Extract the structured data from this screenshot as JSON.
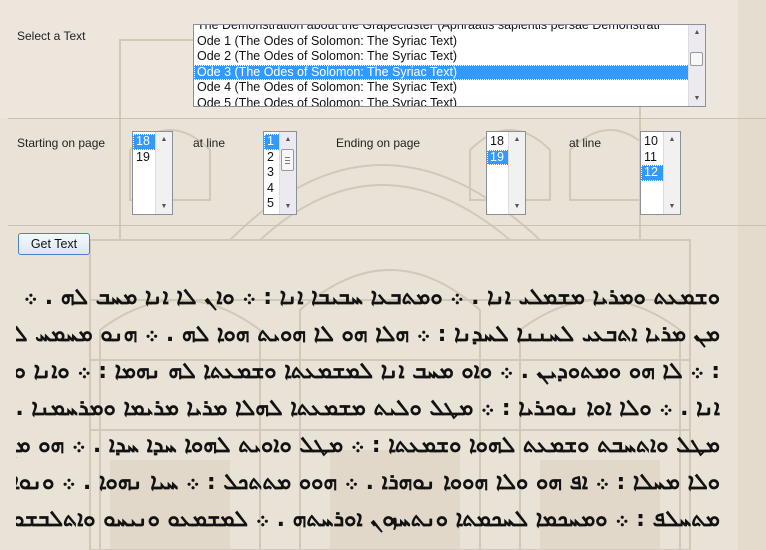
{
  "form": {
    "select_text_label": "Select a Text",
    "texts": [
      "The Demonstration about the Grapecluster (Aphraatis sapientis persae Demonstrati",
      "Ode 1 (The Odes of Solomon: The Syriac Text)",
      "Ode 2 (The Odes of Solomon: The Syriac Text)",
      "Ode 3 (The Odes of Solomon: The Syriac Text)",
      "Ode 4 (The Odes of Solomon: The Syriac Text)",
      "Ode 5 (The Odes of Solomon: The Syriac Text)"
    ],
    "selected_text": "Ode 3 (The Odes of Solomon: The Syriac Text)",
    "starting_page_label": "Starting on page",
    "start_pages": [
      "18",
      "19"
    ],
    "start_page_selected": "18",
    "start_line_label": "at line",
    "start_lines": [
      "1",
      "2",
      "3",
      "4",
      "5"
    ],
    "start_line_selected": "1",
    "ending_page_label": "Ending on page",
    "end_pages": [
      "18",
      "19"
    ],
    "end_page_selected": "19",
    "end_line_label": "at line",
    "end_lines": [
      "10",
      "11",
      "12"
    ],
    "end_line_selected": "12",
    "get_text_button": "Get Text"
  },
  "output": {
    "lines": [
      "ܘܫܡܥܬ ܘܡܪܝܐ ܡܫܡܠܝ ܐܢܐ . ܀ ܘܡܬܒܥܐ ܚܒܝܒܐ ܐܢܐ : ܀ ܘܐܢ ܠܐ ܐܢܐ ܡܚܒ ܠܗ . ܀ ܠܐ",
      "ܡܢ ܡܪܝܐ ܐܬܒܥܝ ܠܚܢܢܐ ܠܚܕܢܐ : ܀ ܗܠܐ ܗܘ ܠܐ ܗܘܝܬ ܗܘܐ ܠܗ . ܀ ܗܢܘ ܡܚܡܚ ܠܚܒܝܒܗ ܘܫܡܥܬܐ",
      ": ܀ ܠܐ ܗܘ ܘܡܬܘܕܝܢ . ܀ ܘܐܘ ܡܚܒ ܐܢܐ ܠܡܫܡܥܬܐ ܘܫܡܥܬܐ ܠܗ ܢܗܡܐ : ܀ ܘܐܢܐ ܘܡܫܡܗ ܐܦ ܐܢܐ",
      "ܐܢܐ . ܀ ܘܠܐ ܐܘܐ ܢܘܟܪܝܐ : ܀ ܡܛܠ ܘܠܝܬ ܡܫܡܥܬܐ ܠܗܠܐ ܡܪܝܐ ܡܪܝܡܐ ܘܡܪܚܡܢܐ . ܀ ܠܐܬܚܠܦܘ",
      "ܡܛܠ ܘܐܬܚܒܬ ܘܫܡܥܬ ܠܗܘܐ ܘܫܡܥܬܐ : ܀ ܡܛܠ ܘܐܘܝܬ ܠܗܘܐ ܚܕܐ ܚܕܐ . ܀ ܗܘ ܡܢ ܘܡܬܢܝܚ ܠܗܘܐ",
      "ܘܠܐ ܡܚܠܐ : ܀ ܐܦ ܗܘ ܘܠܐ ܗܘܘܐ ܢܘܗܪܐ . ܀ ܗܘܘ ܡܬܬܟܠ : ܀ ܚܝܐ ܢܗܘܐ . ܀ ܘܢܘܐ ܗܢ ܘܫܡܗ ܘܡܪܝܐ ܘܠܐ",
      "ܡܬܚܠܦ : ܀ ܘܡܚܟܡܐ ܠܚܟܡܬܐ ܘܢܬܚܙܘܢ ܐܘܪܚܬܗ . ܀ ܠܡܫܡܥܘ ܘܢܝܚܘ ܘܐܬܠܒܫܘ . ܀ ܗܠܠܘܝܐ"
    ]
  },
  "colors": {
    "selection": "#3399ff",
    "button_border": "#4d80c8"
  }
}
